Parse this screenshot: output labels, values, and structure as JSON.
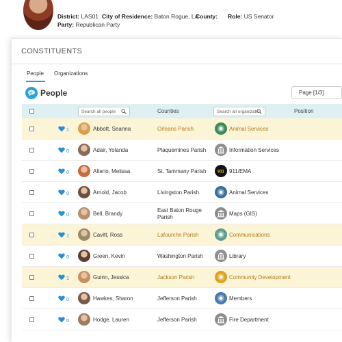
{
  "profile": {
    "district_label": "District:",
    "district_value": "LAS01",
    "city_label": "City of Residence:",
    "city_value": "Baton Rogue, LA",
    "county_label": "County:",
    "county_value": "",
    "role_label": "Role:",
    "role_value": "US Senator",
    "party_label": "Party:",
    "party_value": "Republican Party"
  },
  "card": {
    "title": "CONSTITUENTS"
  },
  "tabs": [
    {
      "label": "People",
      "active": true
    },
    {
      "label": "Organizations",
      "active": false
    }
  ],
  "section": {
    "heading": "People",
    "page_label": "Page [1/3]"
  },
  "table": {
    "search_people_placeholder": "Search all people",
    "counties_header": "Counties",
    "search_orgs_placeholder": "Search all organizatio",
    "position_header": "Position",
    "rows": [
      {
        "likes": "1",
        "name": "Abbott, Seanna",
        "county": "Orleans Parish",
        "org": "Animal Services",
        "highlight": true,
        "avatar_color": "#d9a04a",
        "org_icon": "animal-services-icon",
        "org_color": "#3b8a5a"
      },
      {
        "likes": "0",
        "name": "Adair, Yolanda",
        "county": "Plaquemines Parish",
        "org": "Information Services",
        "highlight": false,
        "avatar_color": "#8a6a5a",
        "org_icon": "government-building-icon",
        "org_color": "#8e8e8e"
      },
      {
        "likes": "0",
        "name": "Alterio, Melissa",
        "county": "St. Tammany Parish",
        "org": "911/EMA",
        "highlight": false,
        "avatar_color": "#c86a3c",
        "org_icon": "emergency-911-icon",
        "org_color": "#111111"
      },
      {
        "likes": "0",
        "name": "Arnold, Jacob",
        "county": "Livingston Parish",
        "org": "Animal Services",
        "highlight": false,
        "avatar_color": "#6a5040",
        "org_icon": "animal-services-icon",
        "org_color": "#3b6fa0"
      },
      {
        "likes": "0",
        "name": "Bell, Brandy",
        "county": "East Baton Rouge Parish",
        "org": "Maps (GIS)",
        "highlight": false,
        "avatar_color": "#b89070",
        "org_icon": "government-building-icon",
        "org_color": "#8e8e8e"
      },
      {
        "likes": "1",
        "name": "Cavitt, Ross",
        "county": "Lafourche Parish",
        "org": "Communications",
        "highlight": true,
        "avatar_color": "#9a8a6a",
        "org_icon": "communications-icon",
        "org_color": "#5aa08a"
      },
      {
        "likes": "0",
        "name": "Green, Kevin",
        "county": "Washington Parish",
        "org": "Library",
        "highlight": false,
        "avatar_color": "#5a4030",
        "org_icon": "government-building-icon",
        "org_color": "#8e8e8e"
      },
      {
        "likes": "1",
        "name": "Guinn, Jessica",
        "county": "Jackson Parish",
        "org": "Community Development",
        "highlight": true,
        "avatar_color": "#c89060",
        "org_icon": "community-development-icon",
        "org_color": "#e0a020"
      },
      {
        "likes": "0",
        "name": "Hawkes, Sharon",
        "county": "Jefferson Parish",
        "org": "Members",
        "highlight": false,
        "avatar_color": "#7a5a4a",
        "org_icon": "members-icon",
        "org_color": "#4a7ab0"
      },
      {
        "likes": "0",
        "name": "Hodge, Lauren",
        "county": "Jefferson Parish",
        "org": "Fire Department",
        "highlight": false,
        "avatar_color": "#a07a5a",
        "org_icon": "government-building-icon",
        "org_color": "#8e8e8e"
      }
    ]
  },
  "colors": {
    "accent": "#1a9ad6",
    "header_bg": "#dff0f2",
    "highlight_row": "#fcf4d7",
    "highlight_text": "#b07a14"
  }
}
